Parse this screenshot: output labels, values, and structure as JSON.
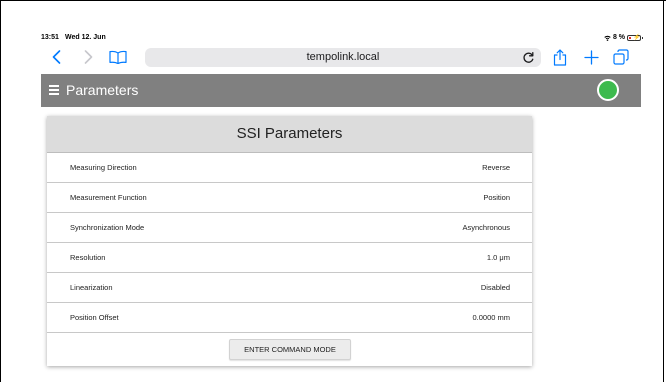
{
  "status_bar": {
    "time": "13:51",
    "date": "Wed 12. Jun",
    "battery_text": "8 %"
  },
  "browser": {
    "url": "tempolink.local",
    "icons": [
      "back-icon",
      "forward-icon",
      "bookmarks-icon",
      "reload-icon",
      "share-icon",
      "new-tab-icon",
      "tabs-icon"
    ],
    "accent_color": "#007aff"
  },
  "app_bar": {
    "title": "Parameters",
    "background": "#808080",
    "status_color": "#3dba4e"
  },
  "card": {
    "title": "SSI Parameters",
    "rows": [
      {
        "label": "Measuring Direction",
        "value": "Reverse"
      },
      {
        "label": "Measurement Function",
        "value": "Position"
      },
      {
        "label": "Synchronization Mode",
        "value": "Asynchronous"
      },
      {
        "label": "Resolution",
        "value": "1.0 μm"
      },
      {
        "label": "Linearization",
        "value": "Disabled"
      },
      {
        "label": "Position Offset",
        "value": "0.0000 mm"
      }
    ],
    "button_label": "ENTER COMMAND MODE"
  }
}
